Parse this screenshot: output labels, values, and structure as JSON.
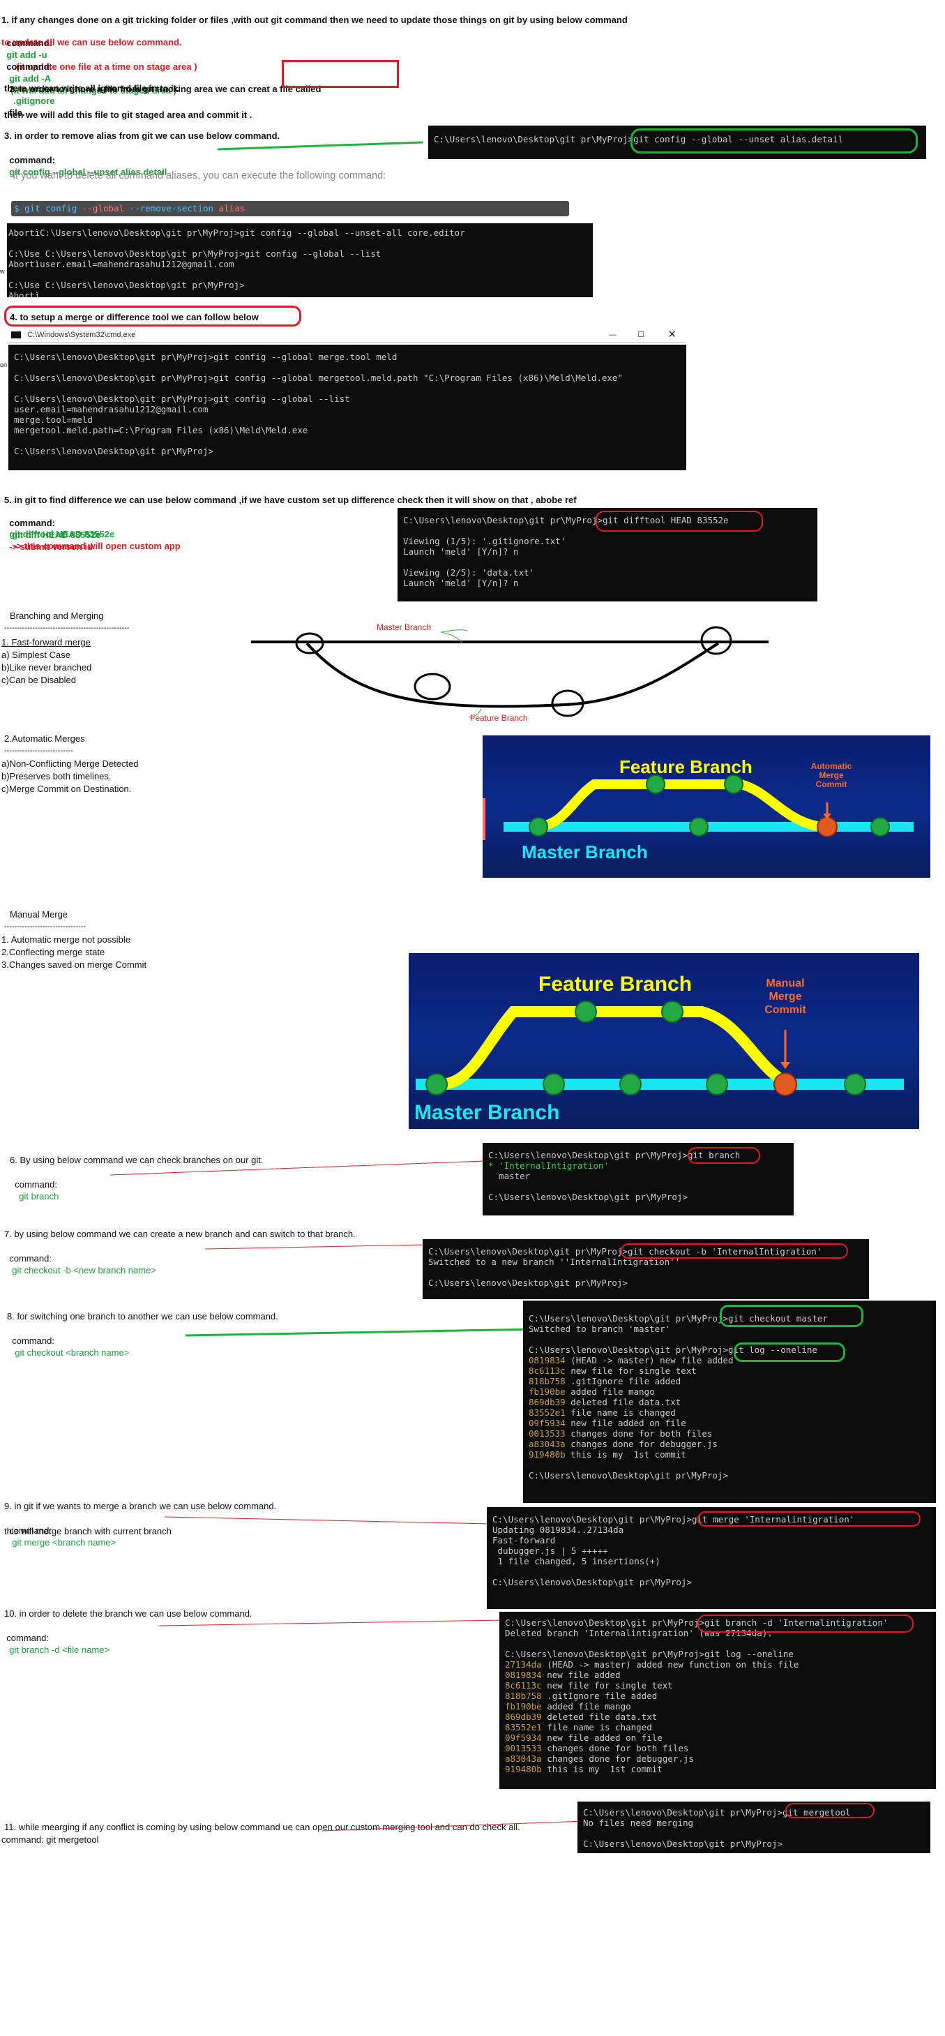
{
  "s1": {
    "line1": "1. if any changes done on a git tricking folder or files ,with out git command then we need to update those things on git by using below command",
    "cmd_label": "command:",
    "cmd1": "git add -u",
    "cmd1_note": "(it update one file at a time on stage area )",
    "line3": "to update all we can use below command.",
    "cmd2": "git add -A",
    "cmd2_note": "(it will add all changes to staged area )"
  },
  "s2": {
    "line1a": "2. in order to ignore a file from git tracking area we can creat a file called",
    "gitignore": ".gitignore",
    "line1b": "file.",
    "line2": "there we can write all ignored file in to it.",
    "line3": "then we will add this file to git staged area and commit it ."
  },
  "s3": {
    "line1": "3. in order to remove alias from git we can use below command.",
    "cmd_label": "command:",
    "cmd": "git config --global --unset alias.detail",
    "term": "C:\\Users\\lenovo\\Desktop\\git pr\\MyProj>git config --global --unset alias.detail",
    "hint": "If you want to delete all command aliases, you can execute the following command:",
    "code_a": "$ git config",
    "code_b": "--global",
    "code_c": "--remove-section",
    "code_d": "alias",
    "term2": "AbortìC:\\Users\\lenovo\\Desktop\\git pr\\MyProj>git config --global --unset-all core.editor\n\nC:\\Use C:\\Users\\lenovo\\Desktop\\git pr\\MyProj>git config --global --list\nAbortìuser.email=mahendrasahu1212@gmail.com\n\nC:\\Use C:\\Users\\lenovo\\Desktop\\git pr\\MyProj>\nAbortì"
  },
  "s4": {
    "title": "4. to setup a merge or difference tool we can follow below",
    "window_title": "C:\\Windows\\System32\\cmd.exe",
    "term": "C:\\Users\\lenovo\\Desktop\\git pr\\MyProj>git config --global merge.tool meld\n\nC:\\Users\\lenovo\\Desktop\\git pr\\MyProj>git config --global mergetool.meld.path \"C:\\Program Files (x86)\\Meld\\Meld.exe\"\n\nC:\\Users\\lenovo\\Desktop\\git pr\\MyProj>git config --global --list\nuser.email=mahendrasahu1212@gmail.com\nmerge.tool=meld\nmergetool.meld.path=C:\\Program Files (x86)\\Meld\\Meld.exe\n\nC:\\Users\\lenovo\\Desktop\\git pr\\MyProj>"
  },
  "s5": {
    "line1": "5. in git to find difference we can use below command ,if we have custom set up difference check then it will show on that , abobe ref",
    "cmd_label": "command:",
    "cmd1": "git diff HEAD 83552e",
    "cmd1_note": "-> submit verson id",
    "cmd2": "git difftool HEAD 83552e",
    "cmd2_note": "-> this command will open custom app",
    "term": "C:\\Users\\lenovo\\Desktop\\git pr\\MyProj>git difftool HEAD 83552e\n\nViewing (1/5): '.gitignore.txt'\nLaunch 'meld' [Y/n]? n\n\nViewing (2/5): 'data.txt'\nLaunch 'meld' [Y/n]? n"
  },
  "branching": {
    "title": "Branching and Merging",
    "dashes": "-------------------------------------------------",
    "ff_title": "1. Fast-forward merge",
    "ff_a": "a) Simplest Case",
    "ff_b": "b)Like never branched",
    "ff_c": "c)Can be Disabled",
    "master_label": "Master Branch",
    "feature_label": "Feature Branch",
    "auto_title": "2.Automatic Merges",
    "auto_dashes": "---------------------------",
    "auto_a": "a)Non-Conflicting Merge Detected",
    "auto_b": "b)Preserves both timelines.",
    "auto_c": "c)Merge Commit on Destination.",
    "diag1_feature": "Feature Branch",
    "diag1_master": "Master Branch",
    "diag1_commit": "Automatic\nMerge\nCommit",
    "manual_title": "Manual Merge",
    "manual_dashes": "--------------------------------",
    "manual_1": "1. Automatic merge not possible",
    "manual_2": "2.Conflecting merge state",
    "manual_3": "3.Changes saved on merge Commit",
    "diag2_feature": "Feature Branch",
    "diag2_master": "Master Branch",
    "diag2_commit": "Manual\nMerge\nCommit"
  },
  "s6": {
    "line1": "6. By using below command we can check branches on our git.",
    "cmd_label": "command:",
    "cmd": "git branch",
    "term_l1": "C:\\Users\\lenovo\\Desktop\\git pr\\MyProj>git branch",
    "term_l2": "* 'InternalIntigration'",
    "term_l3": "  master",
    "term_l4": "C:\\Users\\lenovo\\Desktop\\git pr\\MyProj>"
  },
  "s7": {
    "line1": "7. by using below command we can create a new branch and can switch to that branch.",
    "cmd_label": "command:",
    "cmd": "git checkout -b <new branch name>",
    "term": "C:\\Users\\lenovo\\Desktop\\git pr\\MyProj>git checkout -b 'InternalIntigration'\nSwitched to a new branch ''InternalIntigration''\n\nC:\\Users\\lenovo\\Desktop\\git pr\\MyProj>"
  },
  "s8": {
    "line1": "8. for switching one branch to another we can use below command.",
    "cmd_label": "command:",
    "cmd": "git checkout <branch name>",
    "term_top": "C:\\Users\\lenovo\\Desktop\\git pr\\MyProj>git checkout master\nSwitched to branch 'master'\n\nC:\\Users\\lenovo\\Desktop\\git pr\\MyProj>git log --oneline",
    "log": [
      {
        "hash": "0819834",
        "msg": " (HEAD -> master) new file added"
      },
      {
        "hash": "8c6113c",
        "msg": " new file for single text"
      },
      {
        "hash": "818b758",
        "msg": " .gitIgnore file added"
      },
      {
        "hash": "fb190be",
        "msg": " added file mango"
      },
      {
        "hash": "869db39",
        "msg": " deleted file data.txt"
      },
      {
        "hash": "83552e1",
        "msg": " file name is changed"
      },
      {
        "hash": "09f5934",
        "msg": " new file added on file"
      },
      {
        "hash": "0013533",
        "msg": " changes done for both files"
      },
      {
        "hash": "a83043a",
        "msg": " changes done for debugger.js"
      },
      {
        "hash": "919480b",
        "msg": " this is my  1st commit"
      }
    ],
    "term_end": "C:\\Users\\lenovo\\Desktop\\git pr\\MyProj>"
  },
  "s9": {
    "line1": "9. in git if we wants to merge a branch we can use below command.",
    "cmd_label": "command:",
    "cmd": "git merge <branch name>",
    "line3": "this will merge branch with current branch",
    "term": "C:\\Users\\lenovo\\Desktop\\git pr\\MyProj>git merge 'Internalintigration'\nUpdating 0819834..27134da\nFast-forward\n dubugger.js | 5 +++++\n 1 file changed, 5 insertions(+)\n\nC:\\Users\\lenovo\\Desktop\\git pr\\MyProj>"
  },
  "s10": {
    "line1": "10. in order to delete the branch we can use below command.",
    "cmd_label": "command:",
    "cmd": "git branch -d <file name>",
    "term_top": "C:\\Users\\lenovo\\Desktop\\git pr\\MyProj>git branch -d 'Internalintigration'\nDeleted branch 'Internalintigration' (was 27134da).\n\nC:\\Users\\lenovo\\Desktop\\git pr\\MyProj>git log --oneline",
    "log": [
      {
        "hash": "27134da",
        "msg": " (HEAD -> master) added new function on this file"
      },
      {
        "hash": "0819834",
        "msg": " new file added"
      },
      {
        "hash": "8c6113c",
        "msg": " new file for single text"
      },
      {
        "hash": "818b758",
        "msg": " .gitIgnore file added"
      },
      {
        "hash": "fb190be",
        "msg": " added file mango"
      },
      {
        "hash": "869db39",
        "msg": " deleted file data.txt"
      },
      {
        "hash": "83552e1",
        "msg": " file name is changed"
      },
      {
        "hash": "09f5934",
        "msg": " new file added on file"
      },
      {
        "hash": "0013533",
        "msg": " changes done for both files"
      },
      {
        "hash": "a83043a",
        "msg": " changes done for debugger.js"
      },
      {
        "hash": "919480b",
        "msg": " this is my  1st commit"
      }
    ]
  },
  "s11": {
    "line1": "11. while mearging if any conflict is coming by using below command ue can open our custom merging tool and can do check all.",
    "cmd_line": "command: git mergetool",
    "term": "C:\\Users\\lenovo\\Desktop\\git pr\\MyProj>git mergetool\nNo files need merging\n\nC:\\Users\\lenovo\\Desktop\\git pr\\MyProj>"
  },
  "colors": {
    "green": "#1e9e3a",
    "red": "#e01b24",
    "term_bg": "#0c0c0c",
    "yellow": "#ffff00",
    "cyan": "#19e6f0",
    "diagram_bg": "#0b2a8a"
  }
}
